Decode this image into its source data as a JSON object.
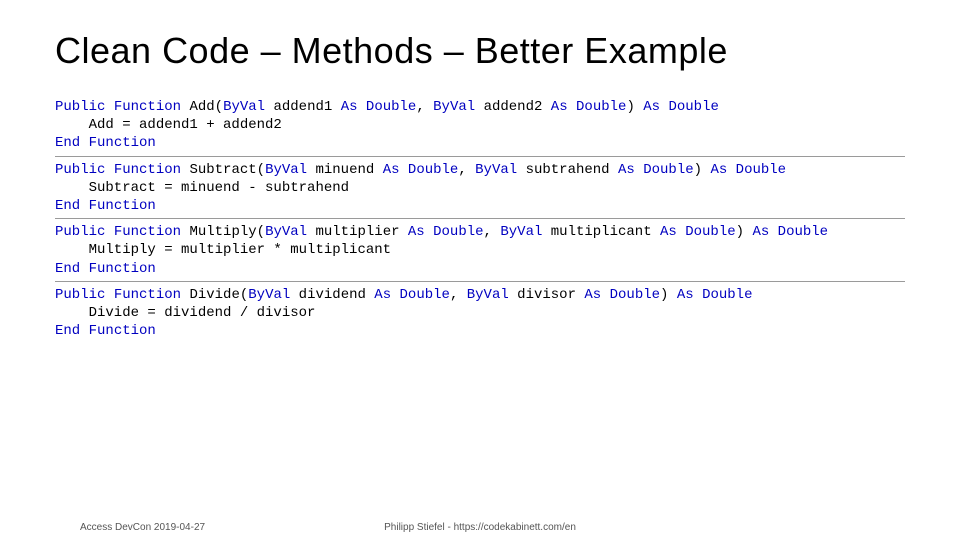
{
  "title": "Clean Code – Methods – Better Example",
  "functions": [
    {
      "sig_pre": "Public Function",
      "name": "Add",
      "params": "(ByVal addend1 As Double, ByVal addend2 As Double) As Double",
      "body": "    Add = addend1 + addend2",
      "end": "End Function"
    },
    {
      "sig_pre": "Public Function",
      "name": "Subtract",
      "params": "(ByVal minuend As Double, ByVal subtrahend As Double) As Double",
      "body": "    Subtract = minuend - subtrahend",
      "end": "End Function"
    },
    {
      "sig_pre": "Public Function",
      "name": "Multiply",
      "params": "(ByVal multiplier As Double, ByVal multiplicant As Double) As Double",
      "body": "    Multiply = multiplier * multiplicant",
      "end": "End Function"
    },
    {
      "sig_pre": "Public Function",
      "name": "Divide",
      "params": "(ByVal dividend As Double, ByVal divisor As Double) As Double",
      "body": "    Divide = dividend / divisor",
      "end": "End Function"
    }
  ],
  "keywords": [
    "Public",
    "Function",
    "ByVal",
    "As",
    "Double",
    "End"
  ],
  "footer": {
    "left": "Access DevCon 2019-04-27",
    "center": "Philipp Stiefel - https://codekabinett.com/en"
  }
}
